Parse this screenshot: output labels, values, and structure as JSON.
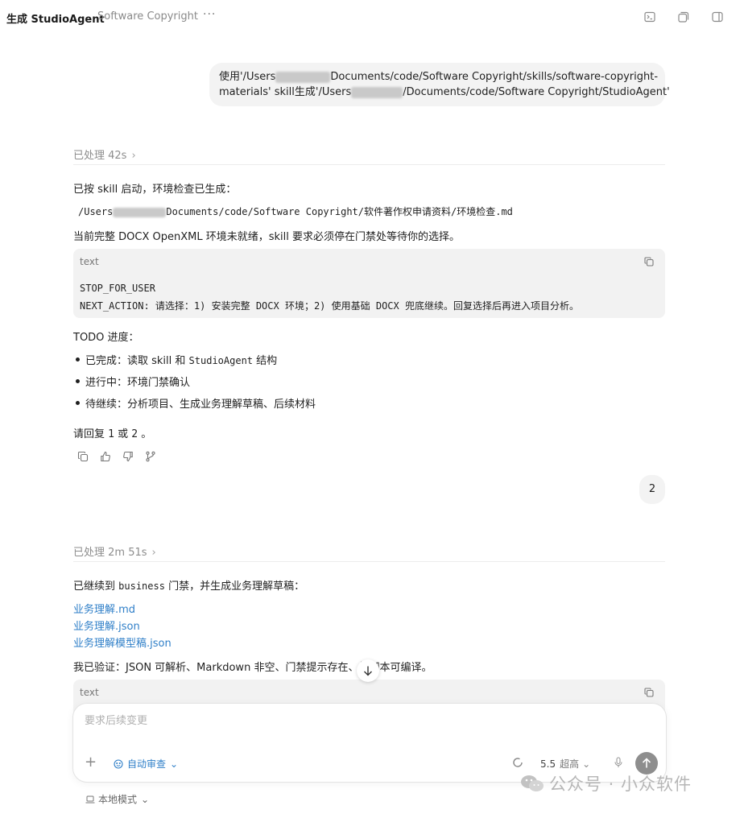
{
  "header": {
    "title": "生成 StudioAgent",
    "subtitle": "Software Copyright",
    "more_label": "···",
    "icons": [
      "terminal-icon",
      "windows-icon",
      "sidebar-toggle-icon"
    ]
  },
  "messages": {
    "user_1": {
      "line1_pre": "使用'/Users",
      "line1_post": "Documents/code/Software Copyright/skills/software-copyright-",
      "line2_pre": "materials' skill生成'/Users",
      "line2_post": "/Documents/code/Software Copyright/StudioAgent'"
    },
    "assistant_1": {
      "processed": "已处理 42s",
      "intro": "已按 skill 启动，环境检查已生成：",
      "path_pre": "/Users",
      "path_post": "Documents/code/Software Copyright/软件著作权申请资料/环境检查.md",
      "status": "当前完整 DOCX OpenXML 环境未就绪，skill 要求必须停在门禁处等待你的选择。",
      "code": {
        "lang": "text",
        "line1": "STOP_FOR_USER",
        "line2": "NEXT_ACTION: 请选择：1) 安装完整 DOCX 环境；2) 使用基础 DOCX 兜底继续。回复选择后再进入项目分析。"
      },
      "todo_title": "TODO 进度：",
      "todo": [
        {
          "label": "已完成：读取 skill 和 ",
          "code": "StudioAgent",
          "suffix": " 结构"
        },
        {
          "label": "进行中：环境门禁确认"
        },
        {
          "label": "待继续：分析项目、生成业务理解草稿、后续材料"
        }
      ],
      "reply_prompt_pre": "请回复 ",
      "reply_prompt_1": "1",
      "reply_prompt_mid": " 或 ",
      "reply_prompt_2": "2",
      "reply_prompt_post": " 。",
      "feedback_icons": [
        "copy-icon",
        "thumbs-up-icon",
        "thumbs-down-icon",
        "branch-icon"
      ]
    },
    "user_2": {
      "text": "2"
    },
    "assistant_2": {
      "processed": "已处理 2m 51s",
      "intro_pre": "已继续到 ",
      "intro_code": "business",
      "intro_post": " 门禁，并生成业务理解草稿：",
      "links": [
        "业务理解.md",
        "业务理解.json",
        "业务理解模型稿.json"
      ],
      "verify_pre": "我已验证：JSON 可解析、Markdown 非空、门禁提示存在、校",
      "verify_post": "脚本可编译。",
      "code": {
        "lang": "text"
      }
    }
  },
  "composer": {
    "placeholder": "要求后续变更",
    "add_label": "+",
    "auto_review_label": "自动审查",
    "model_label": "5.5",
    "effort_label": "超高",
    "local_mode_label": "本地模式"
  },
  "watermark": {
    "text": "公众号 · 小众软件"
  },
  "colors": {
    "link": "#2f7fc8",
    "bubble": "#f3f3f3",
    "code_bg": "#f2f2f2"
  }
}
